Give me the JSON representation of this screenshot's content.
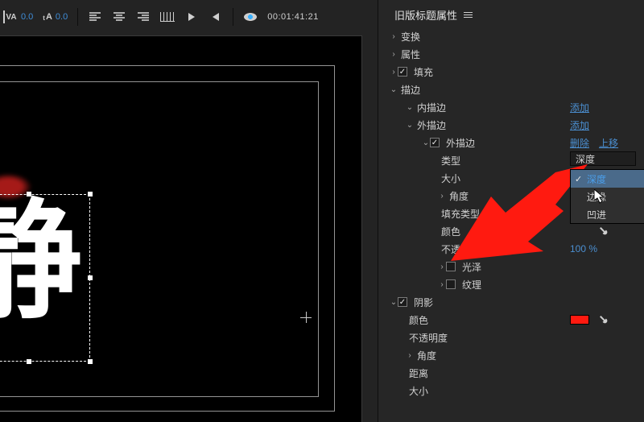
{
  "toolbar": {
    "va_value": "0.0",
    "ta_value": "0.0",
    "timecode": "00:01:41:21"
  },
  "title_text": "静",
  "panel": {
    "title": "旧版标题属性",
    "sections": {
      "transform": "变换",
      "attributes": "属性",
      "fill": "填充",
      "stroke": "描边",
      "inner_stroke": "内描边",
      "outer_stroke": "外描边",
      "outer_stroke_child": "外描边",
      "type": "类型",
      "size": "大小",
      "angle": "角度",
      "fill_type": "填充类型",
      "color": "颜色",
      "opacity": "不透明度",
      "sheen": "光泽",
      "texture": "纹理",
      "shadow": "阴影",
      "shadow_color": "颜色",
      "shadow_opacity": "不透明度",
      "shadow_angle": "角度",
      "shadow_distance": "距离",
      "shadow_size": "大小"
    },
    "links": {
      "add": "添加",
      "delete": "删除",
      "moveup": "上移"
    },
    "values": {
      "type_selected": "深度",
      "opacity": "100 %"
    },
    "type_options": {
      "depth": "深度",
      "edge": "边缘",
      "inset": "凹进"
    }
  }
}
